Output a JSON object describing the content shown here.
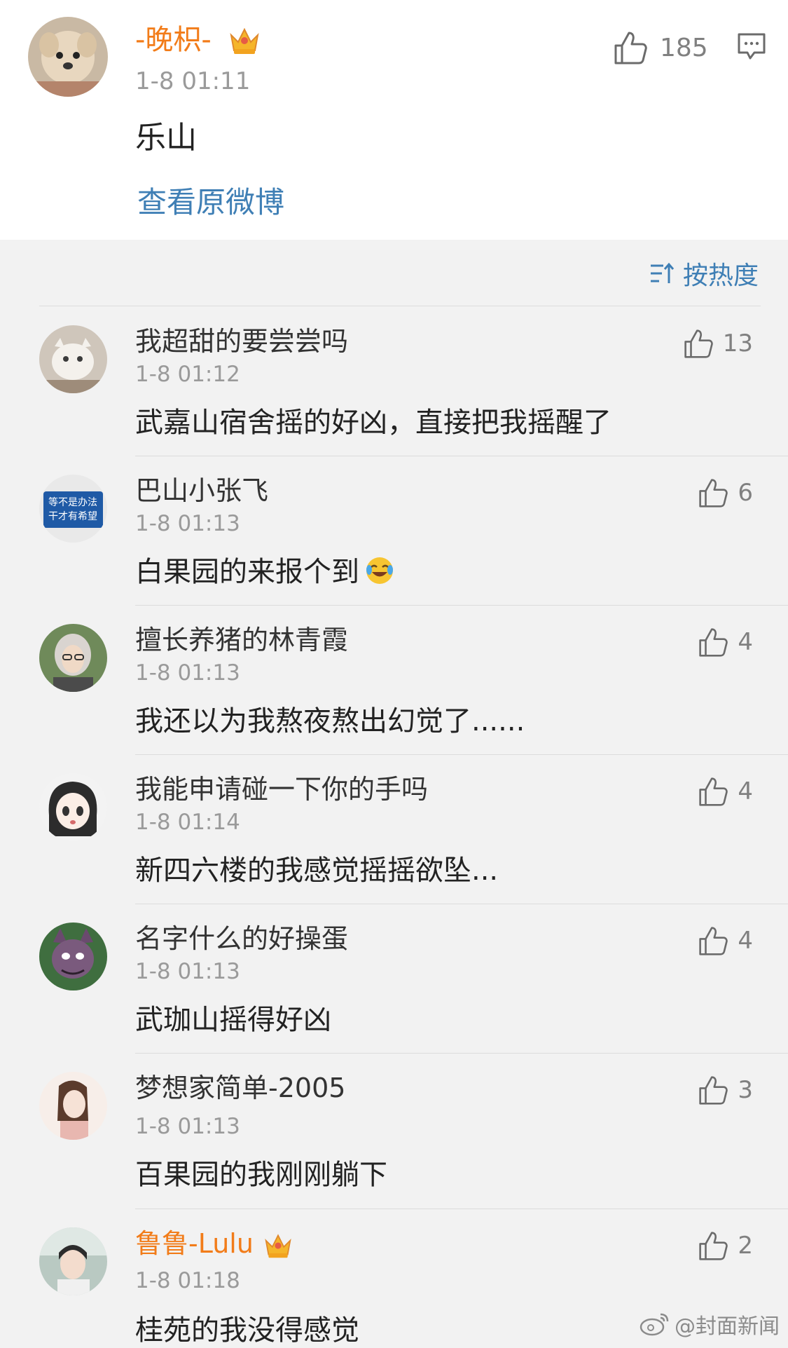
{
  "post": {
    "author": "-晚枳-",
    "time": "1-8 01:11",
    "content": "乐山",
    "likes": "185",
    "view_original": "查看原微博"
  },
  "sort": {
    "label": "按热度"
  },
  "comments": [
    {
      "name": "我超甜的要尝尝吗",
      "time": "1-8 01:12",
      "text": "武嘉山宿舍摇的好凶，直接把我摇醒了",
      "likes": "13"
    },
    {
      "name": "巴山小张飞",
      "time": "1-8 01:13",
      "text": "白果园的来报个到",
      "likes": "6",
      "avatar_sign": [
        "等不是办法",
        "干才有希望"
      ]
    },
    {
      "name": "擅长养猪的林青霞",
      "time": "1-8 01:13",
      "text": "我还以为我熬夜熬出幻觉了......",
      "likes": "4"
    },
    {
      "name": "我能申请碰一下你的手吗",
      "time": "1-8 01:14",
      "text": "新四六楼的我感觉摇摇欲坠...",
      "likes": "4"
    },
    {
      "name": "名字什么的好操蛋",
      "time": "1-8 01:13",
      "text": "武珈山摇得好凶",
      "likes": "4"
    },
    {
      "name": "梦想家简单-2005",
      "time": "1-8 01:13",
      "text": "百果园的我刚刚躺下",
      "likes": "3"
    },
    {
      "name": "鲁鲁-Lulu",
      "time": "1-8 01:18",
      "text": "桂苑的我没得感觉",
      "likes": "2"
    }
  ],
  "watermark": "@封面新闻",
  "colors": {
    "accent_orange": "#f27c19",
    "link_blue": "#3f7fb5",
    "background": "#f2f2f2"
  },
  "icons": [
    "thumbs-up-icon",
    "comment-icon",
    "sort-icon",
    "crown-icon",
    "laugh-cry-emoji",
    "weibo-logo-icon"
  ]
}
